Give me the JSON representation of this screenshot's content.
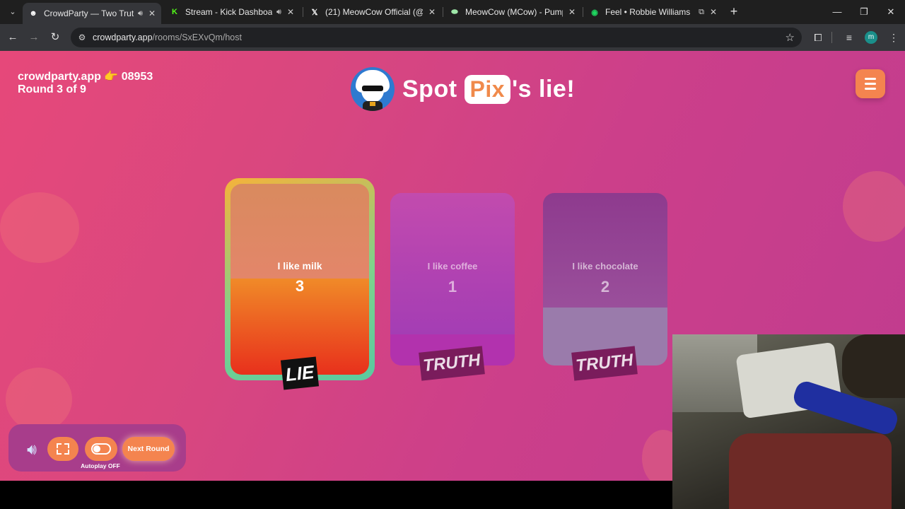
{
  "browser": {
    "tabs": [
      {
        "title": "CrowdParty — Two Truths &",
        "icon": "crowdparty-icon",
        "audio": true,
        "active": true
      },
      {
        "title": "Stream - Kick Dashboard",
        "icon": "kick-icon",
        "audio": true
      },
      {
        "title": "(21) MeowCow Official (@nickt",
        "icon": "x-icon"
      },
      {
        "title": "MeowCow (MCow) - Pump",
        "icon": "pump-icon"
      },
      {
        "title": "Feel • Robbie Williams",
        "icon": "spotify-icon",
        "pip": true
      }
    ],
    "url_host": "crowdparty.app",
    "url_path": "/rooms/SxEXvQm/host",
    "profile_initial": "m"
  },
  "game": {
    "room_code": "crowdparty.app 👉 08953",
    "round": "Round 3 of 9",
    "heading_prefix": "Spot",
    "player_name": "Pix",
    "heading_suffix": "'s lie!",
    "cards": [
      {
        "statement": "I like milk",
        "votes": "3",
        "verdict": "LIE"
      },
      {
        "statement": "I like coffee",
        "votes": "1",
        "verdict": "TRUTH"
      },
      {
        "statement": "I like chocolate",
        "votes": "2",
        "verdict": "TRUTH"
      }
    ],
    "autoplay_label": "Autoplay OFF",
    "next_round_label": "Next Round"
  },
  "colors": {
    "accent": "#f4844f",
    "background_start": "#e6487a",
    "background_end": "#c03c8f"
  }
}
